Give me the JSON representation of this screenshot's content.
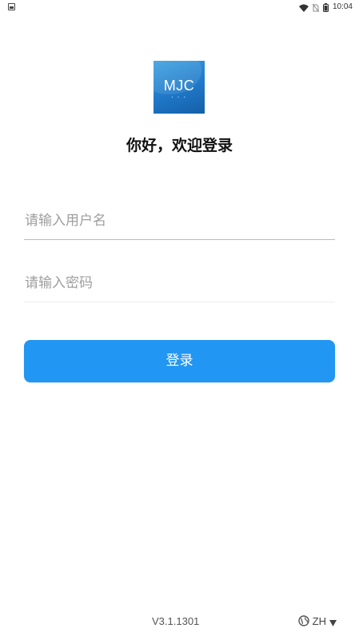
{
  "status_bar": {
    "time": "10:04",
    "icons": [
      "notification-icon",
      "wifi-icon",
      "no-sim-icon",
      "battery-icon"
    ]
  },
  "logo": {
    "text": "MJC",
    "subtext": "• • •",
    "colors": {
      "top": "#3aa0e0",
      "bottom": "#155fa8"
    }
  },
  "title": "你好，欢迎登录",
  "form": {
    "username_placeholder": "请输入用户名",
    "username_value": "",
    "password_placeholder": "请输入密码",
    "password_value": ""
  },
  "login_button": {
    "label": "登录",
    "color": "#2196f3"
  },
  "footer": {
    "version": "V3.1.1301",
    "language": "ZH",
    "language_icon": "globe-icon",
    "dropdown_icon": "caret-down-icon"
  }
}
